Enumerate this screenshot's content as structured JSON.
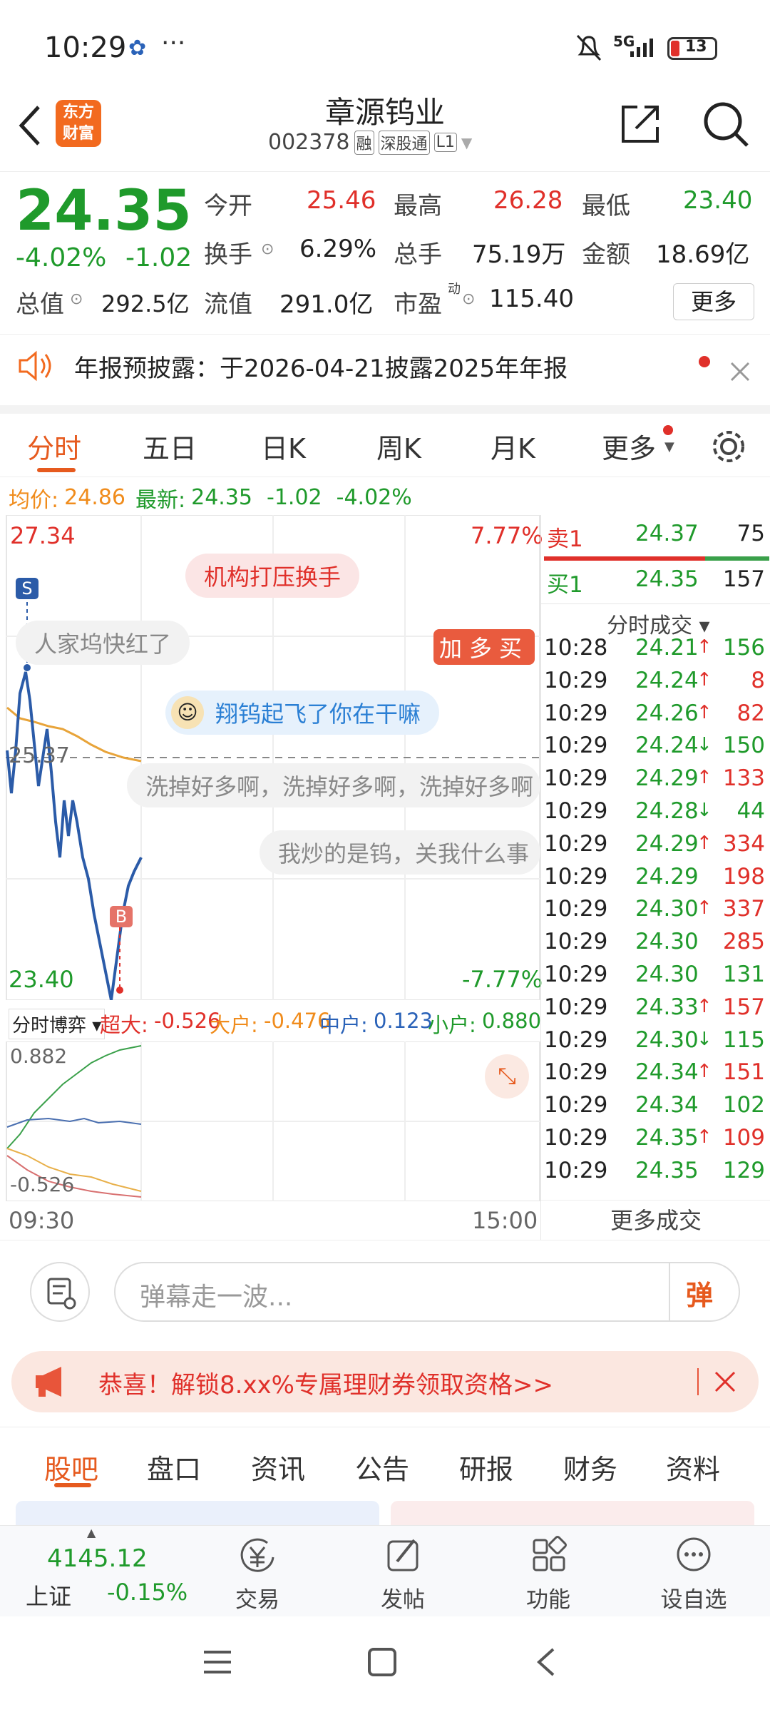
{
  "status": {
    "time": "10:29",
    "network": "5G",
    "battery": "13"
  },
  "header": {
    "logo_line1": "东方",
    "logo_line2": "财富",
    "name": "章源钨业",
    "code": "002378",
    "tags": [
      "融",
      "深股通",
      "L1"
    ]
  },
  "quote": {
    "price": "24.35",
    "change_pct": "-4.02%",
    "change": "-1.02",
    "stats": [
      {
        "label": "今开",
        "value": "25.46"
      },
      {
        "label": "最高",
        "value": "26.28"
      },
      {
        "label": "最低",
        "value": "23.40"
      },
      {
        "label": "换手",
        "value": "6.29%"
      },
      {
        "label": "总手",
        "value": "75.19万"
      },
      {
        "label": "金额",
        "value": "18.69亿"
      },
      {
        "label": "总值",
        "value": "292.5亿"
      },
      {
        "label": "流值",
        "value": "291.0亿"
      },
      {
        "label": "市盈",
        "sup": "动",
        "value": "115.40"
      }
    ],
    "more": "更多"
  },
  "notice": {
    "text": "年报预披露：于2026-04-21披露2025年年报"
  },
  "tabs": [
    "分时",
    "五日",
    "日K",
    "周K",
    "月K",
    "更多"
  ],
  "infobar": {
    "avg_label": "均价:",
    "avg": "24.86",
    "latest_label": "最新:",
    "latest": "24.35",
    "chg": "-1.02",
    "pct": "-4.02%"
  },
  "chart": {
    "top_price": "27.34",
    "top_pct": "7.77%",
    "mid_price": "25.37",
    "bottom_price": "23.40",
    "bottom_pct": "-7.77%",
    "marker_s": "S",
    "marker_b": "B",
    "danmaku": [
      "机构打压换手",
      "人家坞快红了",
      "加多买",
      "翔钨起飞了你在干嘛",
      "洗掉好多啊，洗掉好多啊，洗掉好多啊",
      "我炒的是钨，关我什么事"
    ],
    "time_start": "09:30",
    "time_end": "15:00"
  },
  "fund": {
    "selector": "分时博弈",
    "items": [
      {
        "label": "超大:",
        "value": "-0.526"
      },
      {
        "label": "大户:",
        "value": "-0.476"
      },
      {
        "label": "中户:",
        "value": "0.123"
      },
      {
        "label": "小户:",
        "value": "0.880"
      }
    ],
    "max": "0.882",
    "min": "-0.526"
  },
  "orderbook": {
    "sell1": {
      "label": "卖1",
      "price": "24.37",
      "vol": "75"
    },
    "buy1": {
      "label": "买1",
      "price": "24.35",
      "vol": "157"
    }
  },
  "ticks_title": "分时成交",
  "ticks": [
    {
      "t": "10:28",
      "p": "24.21",
      "d": "↑",
      "v": "156",
      "vc": "green"
    },
    {
      "t": "10:29",
      "p": "24.24",
      "d": "↑",
      "v": "8",
      "vc": "red"
    },
    {
      "t": "10:29",
      "p": "24.26",
      "d": "↑",
      "v": "82",
      "vc": "red"
    },
    {
      "t": "10:29",
      "p": "24.24",
      "d": "↓",
      "v": "150",
      "vc": "green"
    },
    {
      "t": "10:29",
      "p": "24.29",
      "d": "↑",
      "v": "133",
      "vc": "red"
    },
    {
      "t": "10:29",
      "p": "24.28",
      "d": "↓",
      "v": "44",
      "vc": "green"
    },
    {
      "t": "10:29",
      "p": "24.29",
      "d": "↑",
      "v": "334",
      "vc": "red"
    },
    {
      "t": "10:29",
      "p": "24.29",
      "d": "",
      "v": "198",
      "vc": "red"
    },
    {
      "t": "10:29",
      "p": "24.30",
      "d": "↑",
      "v": "337",
      "vc": "red"
    },
    {
      "t": "10:29",
      "p": "24.30",
      "d": "",
      "v": "285",
      "vc": "red"
    },
    {
      "t": "10:29",
      "p": "24.30",
      "d": "",
      "v": "131",
      "vc": "green"
    },
    {
      "t": "10:29",
      "p": "24.33",
      "d": "↑",
      "v": "157",
      "vc": "red"
    },
    {
      "t": "10:29",
      "p": "24.30",
      "d": "↓",
      "v": "115",
      "vc": "green"
    },
    {
      "t": "10:29",
      "p": "24.34",
      "d": "↑",
      "v": "151",
      "vc": "red"
    },
    {
      "t": "10:29",
      "p": "24.34",
      "d": "",
      "v": "102",
      "vc": "green"
    },
    {
      "t": "10:29",
      "p": "24.35",
      "d": "↑",
      "v": "109",
      "vc": "red"
    },
    {
      "t": "10:29",
      "p": "24.35",
      "d": "",
      "v": "129",
      "vc": "green"
    }
  ],
  "more_ticks": "更多成交",
  "comment": {
    "placeholder": "弹幕走一波...",
    "send": "弹"
  },
  "promo": {
    "text": "恭喜！解锁8.xx%专属理财券领取资格>>"
  },
  "bottom_tabs": [
    "股吧",
    "盘口",
    "资讯",
    "公告",
    "研报",
    "财务",
    "资料"
  ],
  "nav": {
    "index_value": "4145.12",
    "index_name": "上证",
    "index_pct": "-0.15%",
    "items": [
      "交易",
      "发帖",
      "功能",
      "设自选"
    ]
  }
}
